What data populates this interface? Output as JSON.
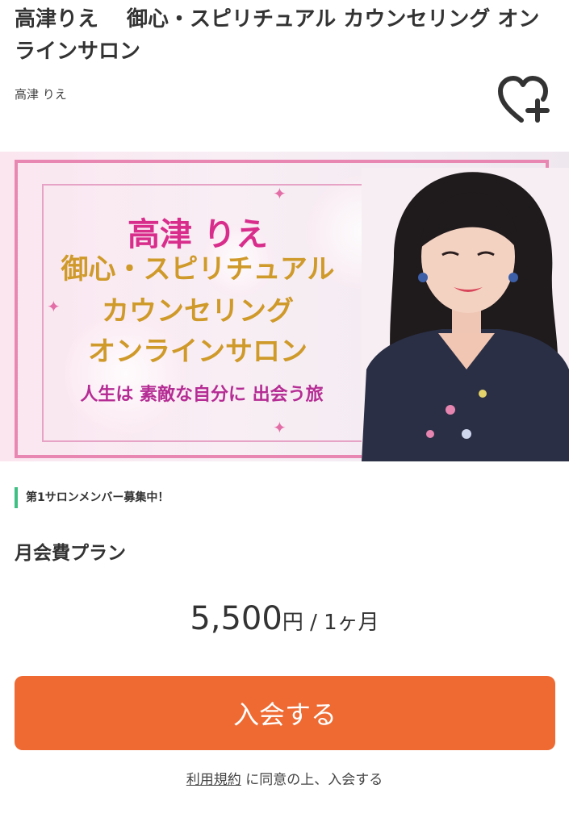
{
  "header": {
    "title": "高津りえ　 御心・スピリチュアル カウンセリング オンラインサロン",
    "author": "高津 りえ",
    "favorite_icon": "heart-plus-icon"
  },
  "banner": {
    "name": "高津 りえ",
    "line1": "御心・スピリチュアル",
    "line2": "カウンセリング",
    "line3": "オンラインサロン",
    "tagline": "人生は 素敵な自分に 出会う旅"
  },
  "recruit_note": "第1サロンメンバー募集中！",
  "plan": {
    "name": "月会費プラン",
    "amount": "5,500",
    "currency": "円",
    "period": " / 1ヶ月"
  },
  "join_button": "入会する",
  "terms": {
    "link": "利用規約",
    "text": "に同意の上、入会する"
  },
  "colors": {
    "accent": "#ee6a32",
    "recruit_bar": "#3fbf82",
    "banner_title": "#d92d8c",
    "banner_gold": "#cf9a2a"
  }
}
